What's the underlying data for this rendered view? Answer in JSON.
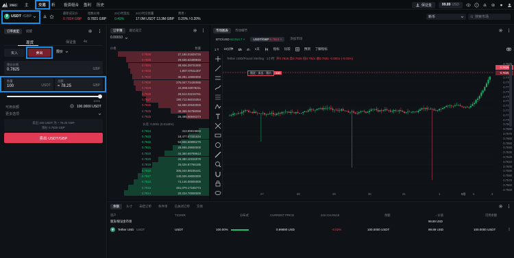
{
  "topnav": {
    "logo_badge": "PRO",
    "items": [
      "主",
      "交易",
      "析",
      "投资组合",
      "盈利",
      "历史"
    ],
    "deposit_label": "保证金",
    "balance": "99.89",
    "currency": "USD"
  },
  "ticker": {
    "pair": "USDT",
    "pair_quote": "/GBP",
    "stats": [
      {
        "label": "最新成交价",
        "value": "0.7824 GBP",
        "color": "#e5485d"
      },
      {
        "label": "指数价格",
        "value": "0.7821 GBP",
        "color": "#e9ebee"
      },
      {
        "label": "24小时变化",
        "value": "0.49%",
        "color": "#1fbf75"
      },
      {
        "label": "24小时交易量",
        "value": "17.0M USDT  13.3M GBP",
        "color": "#e9ebee"
      },
      {
        "label": "费用 ↑",
        "value": "0.20% / 0.20%",
        "color": "#e9ebee"
      }
    ],
    "dropdown": "新币",
    "search_placeholder": "搜索市场"
  },
  "order_form": {
    "tabs": [
      "订单类型",
      "提醒"
    ],
    "mode_tabs": [
      "现货",
      "保证金",
      "4x"
    ],
    "buy_label": "买入",
    "sell_label": "卖出",
    "order_type": "限价",
    "limit_price_label": "限价价格",
    "limit_price": "0.7825",
    "quote": "GBP",
    "qty_label": "数量",
    "qty": "100",
    "qty_unit": "USDT",
    "total_label": "总额",
    "total": "≈ 78.25",
    "total_unit": "GBP",
    "slider_max": "100%",
    "available_label": "可用余额",
    "available": "100.0000 USDT",
    "more_options": "更多选项",
    "summary_line1": "卖出 100 USDT 为 ~ 78.25 GBP",
    "summary_line2": "限价 0.7825 GBP",
    "submit": "卖出 USDT/GBP"
  },
  "orderbook": {
    "tabs": [
      "订单簿",
      "最近成交"
    ],
    "col_price": "价格",
    "col_qty": "数量",
    "spread_value": "0.00010",
    "asks": [
      {
        "price": "0.7836",
        "qty": "27,186.01929725",
        "depth": 0.9
      },
      {
        "price": "0.7835",
        "qty": "29,636.63499946",
        "depth": 0.82
      },
      {
        "price": "0.7834",
        "qty": "28,936.29731000",
        "depth": 0.8
      },
      {
        "price": "0.7833",
        "qty": "1,897.07511307",
        "depth": 0.78
      },
      {
        "price": "0.7832",
        "qty": "30,281.10000000",
        "depth": 0.76
      },
      {
        "price": "0.7830",
        "qty": "275,047.71430065",
        "depth": 0.74
      },
      {
        "price": "0.7829",
        "qty": "24,998.84978211",
        "depth": 0.72
      },
      {
        "price": "0.7828",
        "qty": "28,513.03219761",
        "depth": 0.66
      },
      {
        "price": "0.7827",
        "qty": "190,713.56015354",
        "depth": 0.62
      },
      {
        "price": "0.7826",
        "qty": "84,690.20040000",
        "depth": 0.5
      },
      {
        "price": "0.7825",
        "qty": "48,365.06788058",
        "depth": 0.38
      },
      {
        "price": "0.7825",
        "qty": "26,495.66846374",
        "depth": 0.22
      }
    ],
    "spread_text": "价差: 0.0001 (0.0128%)",
    "bids": [
      {
        "price": "0.7824",
        "qty": "413.99819694",
        "depth": 0.1
      },
      {
        "price": "0.7823",
        "qty": "18,477.57331634",
        "depth": 0.2
      },
      {
        "price": "0.7822",
        "qty": "53,556.66995275",
        "depth": 0.28
      },
      {
        "price": "0.7821",
        "qty": "28,565.29600000",
        "depth": 0.36
      },
      {
        "price": "0.7820",
        "qty": "34,380.69799613",
        "depth": 0.44
      },
      {
        "price": "0.7820",
        "qty": "26,380.10316078",
        "depth": 0.5
      },
      {
        "price": "0.7819",
        "qty": "25,026.87766185",
        "depth": 0.56
      },
      {
        "price": "0.7818",
        "qty": "305,044.88235441",
        "depth": 0.66
      },
      {
        "price": "0.7817",
        "qty": "140,026.49000000",
        "depth": 0.7
      },
      {
        "price": "0.7816",
        "qty": "74,146.00000000",
        "depth": 0.74
      },
      {
        "price": "0.7815",
        "qty": "261,079.17155774",
        "depth": 0.8
      },
      {
        "price": "0.7814",
        "qty": "20,224.70000000",
        "depth": 0.84
      }
    ]
  },
  "chart": {
    "tabs": [
      "市场图表",
      "市场细节"
    ],
    "market_tabs": [
      {
        "label": "BTC/USD",
        "value": "62,914.7",
        "color": "#1fbf75"
      },
      {
        "label": "USDT/GBP",
        "value": "0.7824",
        "color": "#e5485d"
      },
      {
        "label": "添加市场",
        "value": "",
        "color": "#c9ccd1"
      }
    ],
    "intervals": [
      "1 T",
      "15分钟",
      "1h",
      "4h",
      "1天"
    ],
    "toolbar_items": [
      "指标",
      "比较",
      "预测",
      "了解指标"
    ],
    "legend": "Tether USD/Pound Sterling · 1小时",
    "ohlc": "开0.7826 高0.7826 低0.7821 收0.7821 -0.0001 (-0.01%)",
    "order_line_label": "限定 · 卖出 · 限价",
    "order_line_qty": "100",
    "price_ticks": [
      "0.7825",
      "0.7810",
      "0.7800",
      "0.7790",
      "0.7780",
      "0.7770",
      "0.7760",
      "0.7750",
      "0.7740",
      "0.7730",
      "0.7720",
      "0.7710",
      "0.7700",
      "0.7690",
      "0.7680",
      "0.7670",
      "0.7660",
      "0.7650",
      "0.7640",
      "0.7630",
      "0.7620",
      "0.7610",
      "0.7600",
      "0.7590",
      "0.7580",
      "0.7570",
      "0.7560",
      "0.7550"
    ],
    "current_price_label": "0.7826",
    "order_price_label": "0.7825",
    "date_ticks": [
      "27",
      "28",
      "29",
      "30",
      "31",
      "1",
      "2",
      "3"
    ],
    "date_tick_bold": "9月"
  },
  "positions": {
    "tabs": [
      "余额",
      "头寸",
      "未结订单",
      "条件单",
      "已关闭订单",
      "交易"
    ],
    "columns": [
      "资产",
      "TICKER",
      "分布式",
      "CURRENT PRICE",
      "24H CHANGE",
      "余额",
      "↓ 价值",
      "可用余额"
    ],
    "group_label": "现货/保证金市场",
    "group_value": "99.89 USD",
    "rows": [
      {
        "asset": "Tether USD",
        "sub": "USDT",
        "ticker": "USDT",
        "dist": "100.00%",
        "price": "0.99890 USD",
        "change": "-0.02%",
        "balance": "100.0000 USDT",
        "value": "99.89 USD",
        "available": "100.0000 USDT"
      }
    ]
  },
  "colors": {
    "accent": "#1b8ee8",
    "sell": "#e5485d",
    "buy": "#1fbf75",
    "bg": "#0b0e11",
    "panel": "#0f1216"
  }
}
